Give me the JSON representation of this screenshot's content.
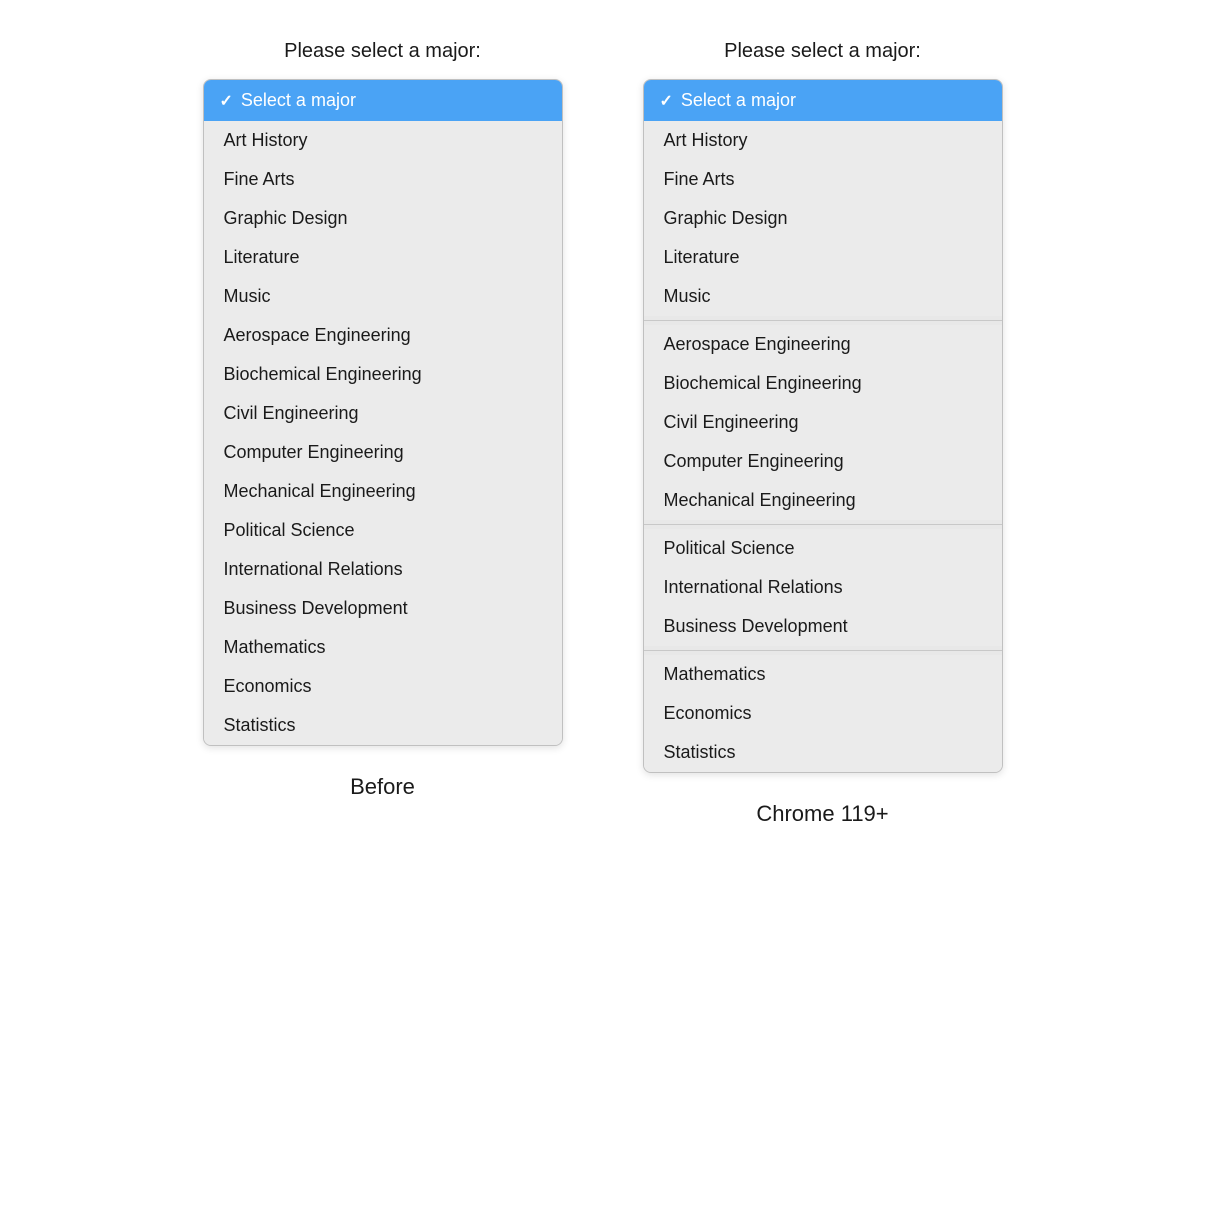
{
  "before": {
    "header": "Please select a major:",
    "footer": "Before",
    "selected": "Select a major",
    "items": [
      {
        "label": "Art History"
      },
      {
        "label": "Fine Arts"
      },
      {
        "label": "Graphic Design"
      },
      {
        "label": "Literature"
      },
      {
        "label": "Music"
      },
      {
        "label": "Aerospace Engineering"
      },
      {
        "label": "Biochemical Engineering"
      },
      {
        "label": "Civil Engineering"
      },
      {
        "label": "Computer Engineering"
      },
      {
        "label": "Mechanical Engineering"
      },
      {
        "label": "Political Science"
      },
      {
        "label": "International Relations"
      },
      {
        "label": "Business Development"
      },
      {
        "label": "Mathematics"
      },
      {
        "label": "Economics"
      },
      {
        "label": "Statistics"
      }
    ]
  },
  "after": {
    "header": "Please select a major:",
    "footer": "Chrome 119+",
    "selected": "Select a major",
    "groups": [
      {
        "items": [
          {
            "label": "Art History"
          },
          {
            "label": "Fine Arts"
          },
          {
            "label": "Graphic Design"
          },
          {
            "label": "Literature"
          },
          {
            "label": "Music"
          }
        ]
      },
      {
        "items": [
          {
            "label": "Aerospace Engineering"
          },
          {
            "label": "Biochemical Engineering"
          },
          {
            "label": "Civil Engineering"
          },
          {
            "label": "Computer Engineering"
          },
          {
            "label": "Mechanical Engineering"
          }
        ]
      },
      {
        "items": [
          {
            "label": "Political Science"
          },
          {
            "label": "International Relations"
          },
          {
            "label": "Business Development"
          }
        ]
      },
      {
        "items": [
          {
            "label": "Mathematics"
          },
          {
            "label": "Economics"
          },
          {
            "label": "Statistics"
          }
        ]
      }
    ]
  },
  "checkmark": "✓"
}
